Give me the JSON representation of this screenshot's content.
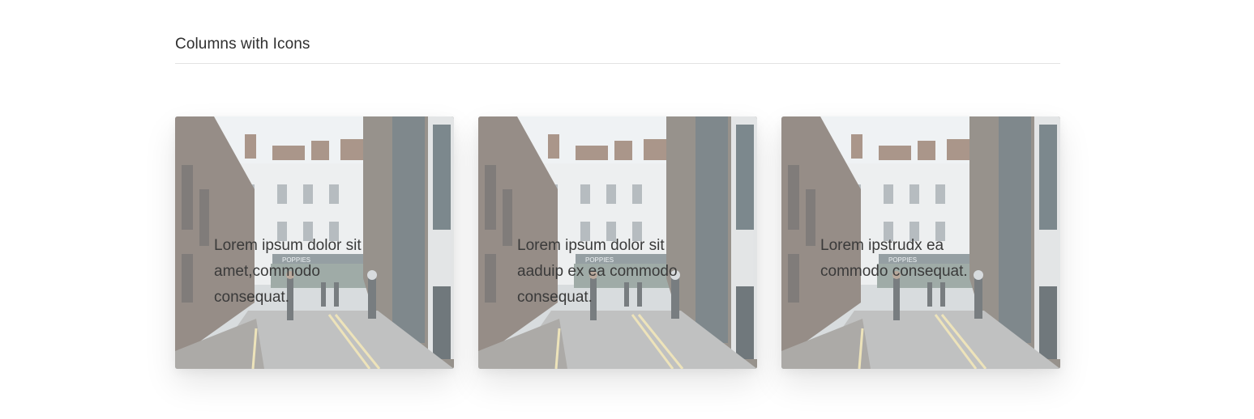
{
  "section": {
    "title": "Columns with Icons"
  },
  "cards": [
    {
      "text": "Lorem ipsum dolor sit amet,commodo consequat."
    },
    {
      "text": "Lorem ipsum dolor sit aaduip ex ea commodo consequat."
    },
    {
      "text": "Lorem ipstrudx ea commodo consequat."
    }
  ],
  "image": {
    "shop_sign": "POPPIES"
  }
}
